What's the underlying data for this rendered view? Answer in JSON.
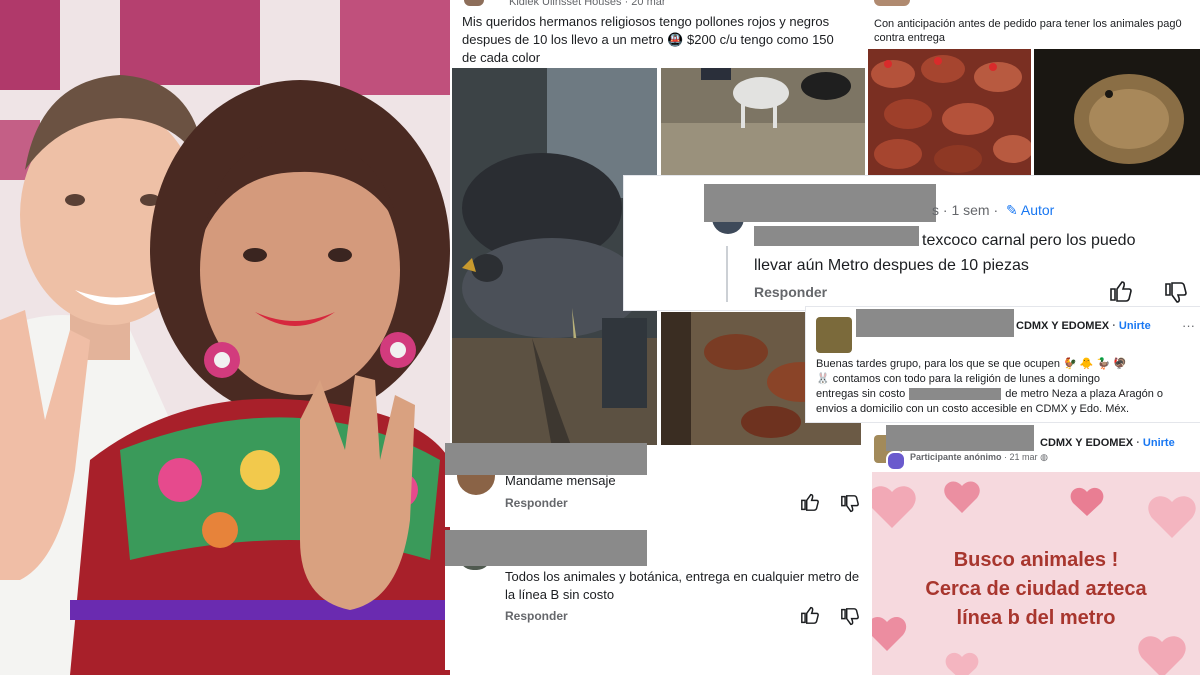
{
  "post1": {
    "author": "Kidlek Ulinsset Houses",
    "time": "20 mar",
    "text_line1": "Mis queridos hermanos religiosos tengo pollones rojos y negros",
    "text_line2": "despues de 10 los llevo a un metro 🚇 $200 c/u tengo como 150",
    "text_line3": "de cada color"
  },
  "post2": {
    "text_line1": "Con anticipación antes de pedido para tener los animales pag0",
    "text_line2": "contra entrega"
  },
  "comment1": {
    "time": "s · 1 sem ·",
    "author_badge": "Autor",
    "text_line1": "texcoco carnal pero los puedo",
    "text_line2": "llevar aún Metro despues de 10 piezas",
    "reply": "Responder"
  },
  "post3": {
    "group": "CDMX Y EDOMEX",
    "join": "Unirte",
    "more": "···",
    "text_line1": "Buenas tardes grupo, para los que se que ocupen 🐓 🐥 🦆 🦃",
    "text_line2": "🐰 contamos con todo para la religión de lunes a domingo",
    "text_line3a": "entregas sin costo",
    "text_line3b": "de metro Neza a plaza Aragón o",
    "text_line4": "envios a domicilio con un costo accesible en CDMX y Edo. Méx."
  },
  "comment2": {
    "text": "Mandame mensaje",
    "reply": "Responder"
  },
  "comment3": {
    "text_line1": "Todos los animales y botánica, entrega en cualquier metro de",
    "text_line2": "la línea B sin costo",
    "reply": "Responder"
  },
  "post4": {
    "group": "CDMX Y EDOMEX",
    "join": "Unirte",
    "author": "Participante anónimo",
    "time": "21 mar",
    "poster_line1": "Busco animales !",
    "poster_line2": "Cerca de ciudad azteca",
    "poster_line3": "línea b del metro"
  },
  "colors": {
    "fb_blue": "#1877f2",
    "meta_gray": "#65676b",
    "poster_text": "#a8362e",
    "poster_bg": "#f6d9de"
  }
}
